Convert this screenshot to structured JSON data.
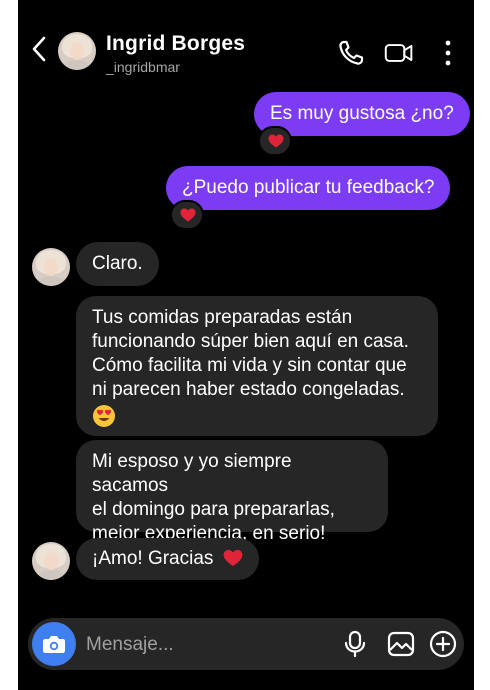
{
  "header": {
    "contact_name": "Ingrid Borges",
    "handle": "_ingridbmar",
    "icons": [
      "back-chevron-icon",
      "avatar",
      "phone-icon",
      "video-camera-icon",
      "more-vertical-icon"
    ]
  },
  "messages": [
    {
      "direction": "outgoing",
      "text": "Es muy gustosa ¿no?",
      "reaction": "heart"
    },
    {
      "direction": "outgoing",
      "text": "¿Puedo publicar tu feedback?",
      "reaction": "heart"
    },
    {
      "direction": "incoming",
      "text": "Claro."
    },
    {
      "direction": "incoming",
      "lines": [
        "Tus comidas preparadas están",
        "funcionando súper bien aquí en casa.",
        "Cómo facilita mi vida y sin contar que",
        "ni parecen haber estado congeladas."
      ],
      "emoji": "heart-eyes"
    },
    {
      "direction": "incoming",
      "lines": [
        "Mi esposo y yo siempre sacamos",
        "el domingo para prepararlas,",
        "mejor experiencia, en serio!"
      ]
    },
    {
      "direction": "incoming",
      "text": "¡Amo! Gracias",
      "emoji": "heart"
    }
  ],
  "composer": {
    "placeholder": "Mensaje...",
    "icons": [
      "camera-icon",
      "microphone-icon",
      "gallery-icon",
      "plus-circle-icon"
    ]
  },
  "colors": {
    "background": "#000000",
    "outgoing_bubble": "#7b3cf3",
    "incoming_bubble": "#262626",
    "camera_button": "#3f7ff0",
    "heart": "#e0243a"
  }
}
